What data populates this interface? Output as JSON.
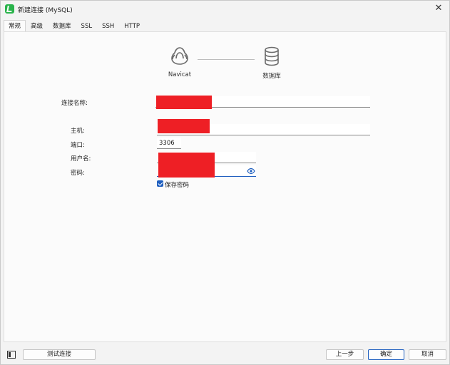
{
  "window": {
    "title": "新建连接 (MySQL)"
  },
  "tabs": [
    {
      "label": "常规",
      "active": true
    },
    {
      "label": "高级",
      "active": false
    },
    {
      "label": "数据库",
      "active": false
    },
    {
      "label": "SSL",
      "active": false
    },
    {
      "label": "SSH",
      "active": false
    },
    {
      "label": "HTTP",
      "active": false
    }
  ],
  "diagram": {
    "client_label": "Navicat",
    "db_label": "数据库"
  },
  "form": {
    "connection_name": {
      "label": "连接名称:",
      "value": ""
    },
    "host": {
      "label": "主机:",
      "value": ""
    },
    "port": {
      "label": "端口:",
      "value": "3306"
    },
    "username": {
      "label": "用户名:",
      "value": ""
    },
    "password": {
      "label": "密码:",
      "value": ""
    },
    "save_password": {
      "label": "保存密码",
      "checked": true
    }
  },
  "buttons": {
    "test": "测试连接",
    "back": "上一步",
    "ok": "确定",
    "cancel": "取消"
  },
  "colors": {
    "accent": "#1f5fbf",
    "redaction": "#ee1f25",
    "app_icon": "#29b34b"
  }
}
